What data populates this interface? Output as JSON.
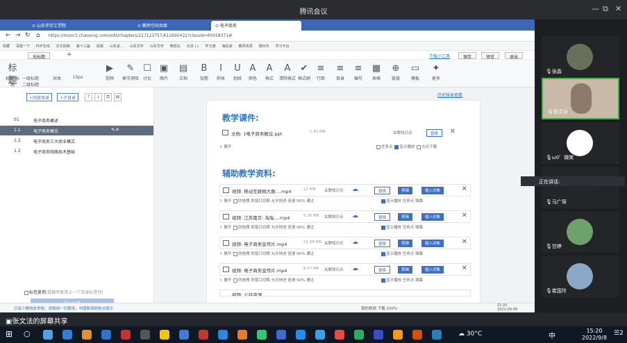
{
  "meeting": {
    "title": "腾讯会议"
  },
  "browser": {
    "tabs": [
      "⊙ 山东华宇工学院",
      "⊙ 教师空间页面",
      "⊙ 电子商务"
    ],
    "url": "https://mooc1.chaoxing.com/edit/chapters/227123757/612690422?classId=60058371#",
    "bookmarks": [
      "收藏",
      "百度一下",
      "PDF在线",
      "论文投稿",
      "第十三届",
      "投稿",
      "山东省…",
      "山东华宇",
      "山东华宇",
      "畅想云",
      "北京 | L",
      "学习通",
      "海投递",
      "教师资源",
      "德州市",
      "学习平台"
    ]
  },
  "editor": {
    "title_chip": "无标题",
    "right_buttons": [
      "下载小工具",
      "保存",
      "预览",
      "退出"
    ],
    "history": "历史版本查看",
    "toolbar": [
      {
        "label": "标题 标题",
        "g": "标题"
      },
      {
        "label": "一级标题 二级标题",
        "g": ""
      },
      {
        "label": "宋体",
        "g": ""
      },
      {
        "label": "10px",
        "g": ""
      },
      {
        "label": "视频",
        "g": "▶"
      },
      {
        "label": "章节测验",
        "g": "✎"
      },
      {
        "label": "讨论",
        "g": "☐"
      },
      {
        "label": "图片",
        "g": "▣"
      },
      {
        "label": "文档",
        "g": "▤"
      },
      {
        "label": "加粗",
        "g": "B"
      },
      {
        "label": "斜体",
        "g": "I"
      },
      {
        "label": "划线",
        "g": "U"
      },
      {
        "label": "颜色",
        "g": "A"
      },
      {
        "label": "格式",
        "g": "A"
      },
      {
        "label": "清除格式",
        "g": "A"
      },
      {
        "label": "格式刷",
        "g": "✔"
      },
      {
        "label": "行距",
        "g": "≡"
      },
      {
        "label": "目录",
        "g": "≡"
      },
      {
        "label": "编号",
        "g": "≡"
      },
      {
        "label": "表格",
        "g": "▦"
      },
      {
        "label": "链接",
        "g": "⊕"
      },
      {
        "label": "模板",
        "g": "▭"
      },
      {
        "label": "更多",
        "g": "✦"
      }
    ]
  },
  "outline": {
    "add_buttons": [
      "+同级目录",
      "+子目录"
    ],
    "chapters": [
      {
        "num": "01",
        "title": "电子商务概述"
      },
      {
        "num": "1.1",
        "title": "电子商务概论"
      },
      {
        "num": "1.2",
        "title": "电子商务三大商业模式"
      },
      {
        "num": "1.3",
        "title": "电子商务网络技术基础"
      }
    ],
    "footer_label": "标签复用",
    "footer_hint": "(数据将复用上一个目录标签列)",
    "footer_btn": "导入标签"
  },
  "content": {
    "heading1": "教学课件:",
    "heading2": "辅助教学资料:",
    "doc_file": {
      "name": "文档: 1电子商务概论.ppt",
      "size": "1.41 MB",
      "tag": "关联知识点",
      "btn": "替换"
    },
    "doc_opts": [
      "任务点",
      "显示播放",
      "允许下载"
    ],
    "videos": [
      {
        "name": "视频: 移动互联网大数....mp4",
        "size": "12 MB"
      },
      {
        "name": "视频: 江苏南京: 淘淘....mp4",
        "size": "6.36 MB"
      },
      {
        "name": "视频: 电子商务宣传片.mp4",
        "size": "51.28 MB"
      },
      {
        "name": "视频: 电子商务宣传片.mp4",
        "size": "8.07 MB"
      }
    ],
    "video_tag": "关联知识点",
    "video_btns": [
      "替换",
      "剪辑",
      "插入对象"
    ],
    "video_opts": "防拖拽  防窗口切换  允许快进  倍速 90%  通过",
    "video_right_opts": "显示播放  任务点  弹幕",
    "partial_row": "视频: 公共资源..."
  },
  "statusbar": {
    "left": "已有少数网友举报，请慎用一切使用，中国新闻网热点提示",
    "right": "我的视频  下载  100%"
  },
  "participants": [
    {
      "name": "张晶",
      "color": "#6a6f5a"
    },
    {
      "name": "张文法",
      "color": "#8d7a6b",
      "speaking": true
    },
    {
      "name": "ω0゜微笑",
      "color": "#ffffff"
    },
    {
      "name": "马广琛",
      "color": "#23262b"
    },
    {
      "name": "甘婷",
      "color": "#6da36a"
    },
    {
      "name": "崔国玲",
      "color": "#8aa9c7"
    }
  ],
  "speaking_label": "正在讲话:",
  "share": {
    "label": "张文法的屏幕共享"
  },
  "taskbar": {
    "weather": "30°C",
    "ime": "中",
    "time": "15:20",
    "date": "2022/9/8",
    "inner_time": "15:20",
    "inner_date": "2022-09-08",
    "notif": "2"
  }
}
